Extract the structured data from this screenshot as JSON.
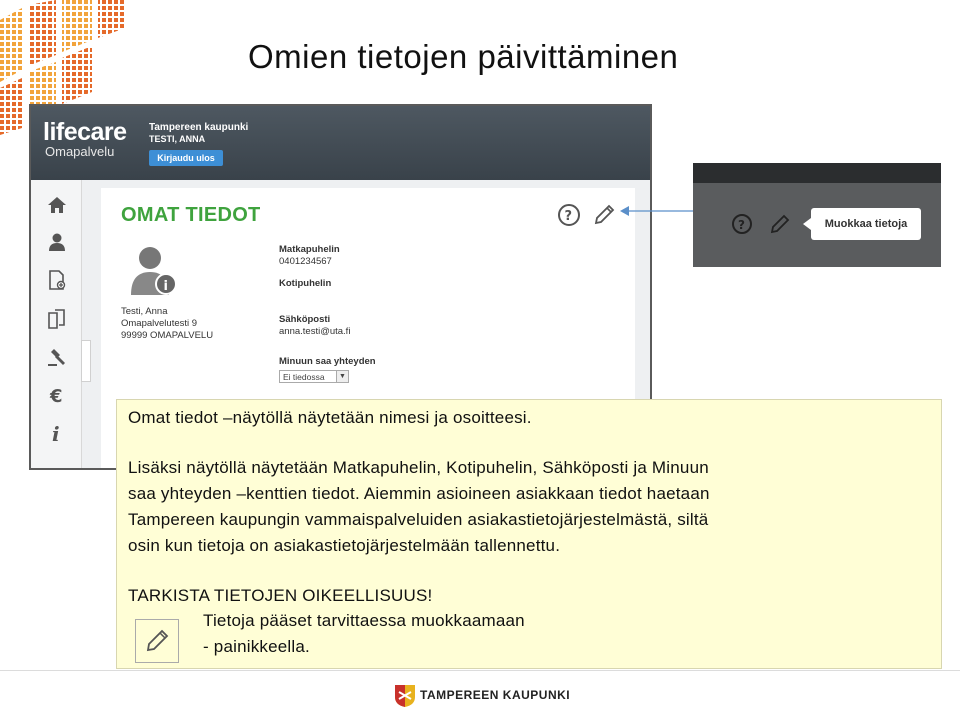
{
  "slide": {
    "title": "Omien tietojen päivittäminen"
  },
  "screenshot": {
    "brand": "lifecare",
    "brand_sub": "Omapalvelu",
    "organization": "Tampereen kaupunki",
    "user_name": "TESTI, ANNA",
    "logout_label": "Kirjaudu ulos",
    "sidebar_icons": [
      "home-icon",
      "person-icon",
      "new-document-icon",
      "documents-icon",
      "gavel-icon",
      "euro-icon",
      "info-icon"
    ],
    "section_title": "OMAT TIEDOT",
    "person": {
      "name": "Testi, Anna",
      "street": "Omapalvelutesti 9",
      "postal": "99999 OMAPALVELU"
    },
    "fields": {
      "mobile_label": "Matkapuhelin",
      "mobile_value": "0401234567",
      "home_phone_label": "Kotipuhelin",
      "email_label": "Sähköposti",
      "email_value": "anna.testi@uta.fi",
      "contact_label": "Minuun saa yhteyden",
      "contact_value": "Ei tiedossa"
    }
  },
  "inset": {
    "tooltip": "Muokkaa tietoja"
  },
  "note": {
    "line1": "Omat tiedot –näytöllä näytetään nimesi ja osoitteesi.",
    "line2": "Lisäksi näytöllä näytetään Matkapuhelin, Kotipuhelin, Sähköposti ja Minuun",
    "line3": "saa yhteyden –kenttien tiedot. Aiemmin asioineen asiakkaan tiedot haetaan",
    "line4": "Tampereen kaupungin vammaispalveluiden asiakastietojärjestelmästä, siltä",
    "line5": "osin kun tietoja on asiakastietojärjestelmään tallennettu.",
    "warning": "TARKISTA TIETOJEN OIKEELLISUUS!",
    "line6": "Tietoja pääset tarvittaessa muokkaamaan",
    "line7": "- painikkeella."
  },
  "footer": {
    "organization": "TAMPEREEN KAUPUNKI"
  },
  "colors": {
    "accent_green": "#3fa33e",
    "header_dark": "#434c55",
    "note_background": "#fffed6",
    "button_blue": "#3d8fd6",
    "deco_orange": "#f3a33a"
  }
}
